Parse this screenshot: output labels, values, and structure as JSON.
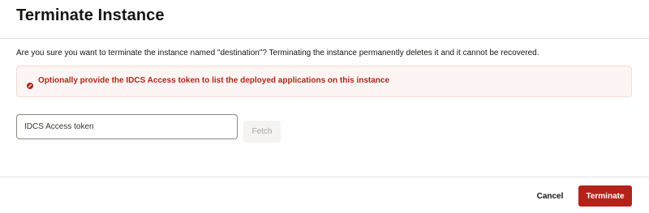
{
  "dialog": {
    "title": "Terminate Instance",
    "message": "Are you sure you want to terminate the instance named \"destination\"? Terminating the instance permanently deletes it and it cannot be recovered."
  },
  "alert": {
    "icon": "error-circle-icon",
    "color": "#b3231a",
    "text": "Optionally provide the IDCS Access token to list the deployed applications on this instance"
  },
  "token_field": {
    "value": "",
    "placeholder": "IDCS Access token"
  },
  "fetch_button": {
    "label": "Fetch",
    "state": "disabled"
  },
  "footer": {
    "cancel_label": "Cancel",
    "terminate_label": "Terminate",
    "terminate_color": "#b3231a"
  }
}
